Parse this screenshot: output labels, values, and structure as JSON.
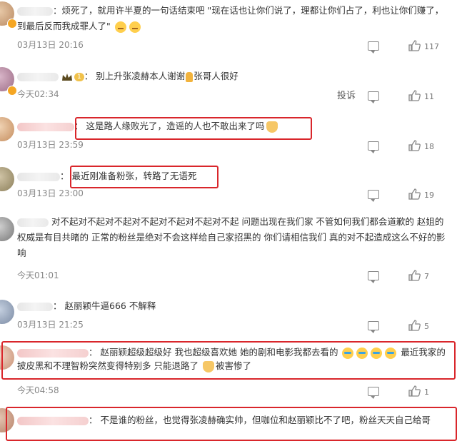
{
  "comments": [
    {
      "text": "烦死了，就用许半夏的一句话结束吧 \"现在话也让你们说了，理都让你们占了，利也让你们赚了，到最后反而我成罪人了\"",
      "time": "03月13日 20:16",
      "likes": "117"
    },
    {
      "text": "别上升张凌赫本人谢谢",
      "text2": "张哥人很好",
      "time": "今天02:34",
      "report": "投诉",
      "likes": "11"
    },
    {
      "text": "这是路人缘败光了，造谣的人也不敢出来了吗",
      "time": "03月13日 23:59",
      "likes": "18"
    },
    {
      "text": "最近刚准备粉张，转路了无语死",
      "time": "03月13日 23:00",
      "likes": "19"
    },
    {
      "text": "对不起对不起对不起对不起对不起对不起对不起 问题出现在我们家 不管如何我们都会道歉的 赵姐的权威是有目共睹的 正常的粉丝是绝对不会这样给自己家招黑的 你们请相信我们 真的对不起造成这么不好的影响",
      "time": "今天01:01",
      "likes": "7"
    },
    {
      "text": "赵丽颖牛逼666 不解释",
      "time": "03月13日 21:25",
      "likes": "5"
    },
    {
      "text": "赵丽颖超级超级好 我也超级喜欢她 她的剧和电影我都去看的",
      "text2": "最近我家的披皮黑和不理智粉突然变得特别多 只能退路了",
      "text3": "被害惨了",
      "time": "今天04:58",
      "likes": "1"
    },
    {
      "text": "不是谁的粉丝，也觉得张凌赫确实帅，但咖位和赵丽颖比不了吧，粉丝天天自己给哥"
    }
  ],
  "colors": {
    "highlight": "#d9262b",
    "muted": "#888888"
  }
}
